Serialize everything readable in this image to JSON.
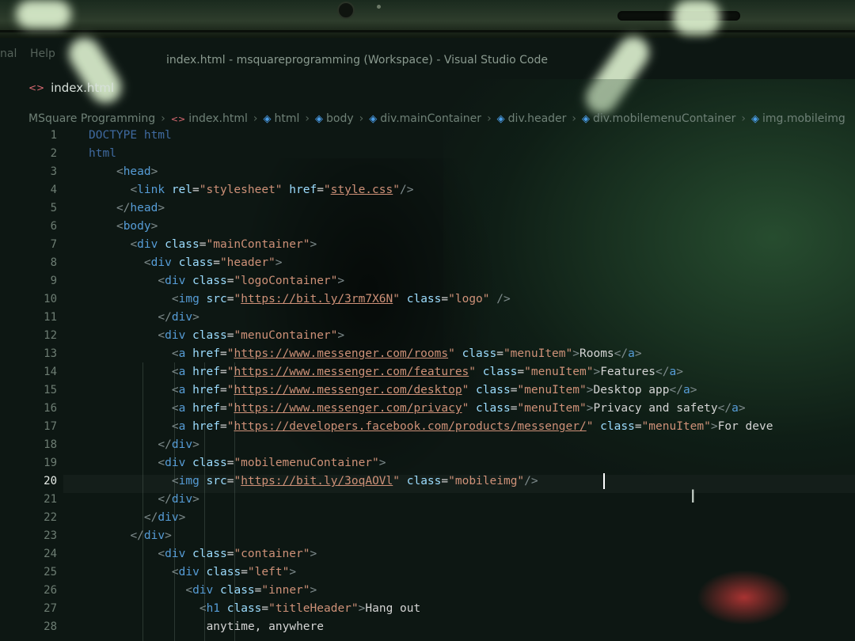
{
  "window": {
    "menu_fragment": "nal",
    "menu_fragment2": "Help",
    "title": "index.html - msquareprogramming (Workspace) - Visual Studio Code"
  },
  "tab": {
    "label": "index.html"
  },
  "breadcrumb": [
    {
      "label": "MSquare Programming",
      "icon": "none"
    },
    {
      "label": "index.html",
      "icon": "html-file-icon"
    },
    {
      "label": "html",
      "icon": "cube-icon"
    },
    {
      "label": "body",
      "icon": "cube-icon"
    },
    {
      "label": "div.mainContainer",
      "icon": "cube-icon"
    },
    {
      "label": "div.header",
      "icon": "cube-icon"
    },
    {
      "label": "div.mobilemenuContainer",
      "icon": "cube-icon"
    },
    {
      "label": "img.mobileimg",
      "icon": "cube-icon"
    }
  ],
  "editor": {
    "active_line": 20,
    "lines": [
      {
        "n": "1",
        "tokens": [
          [
            "dim",
            "DOCTYPE html"
          ]
        ]
      },
      {
        "n": "2",
        "tokens": [
          [
            "dim",
            "html"
          ]
        ]
      },
      {
        "n": "3",
        "tokens": [
          [
            "b",
            "<"
          ],
          [
            "t",
            "head"
          ],
          [
            "b",
            ">"
          ]
        ]
      },
      {
        "n": "4",
        "tokens": [
          [
            "b",
            "<"
          ],
          [
            "t",
            "link "
          ],
          [
            "a",
            "rel"
          ],
          [
            "w",
            "="
          ],
          [
            "s",
            "\"stylesheet\""
          ],
          [
            "w",
            " "
          ],
          [
            "a",
            "href"
          ],
          [
            "w",
            "="
          ],
          [
            "s",
            "\""
          ],
          [
            "u",
            "style.css"
          ],
          [
            "s",
            "\""
          ],
          [
            "b",
            "/>"
          ]
        ]
      },
      {
        "n": "5",
        "tokens": [
          [
            "b",
            "</"
          ],
          [
            "t",
            "head"
          ],
          [
            "b",
            ">"
          ]
        ]
      },
      {
        "n": "6",
        "tokens": [
          [
            "b",
            "<"
          ],
          [
            "t",
            "body"
          ],
          [
            "b",
            ">"
          ]
        ]
      },
      {
        "n": "7",
        "tokens": [
          [
            "b",
            "<"
          ],
          [
            "t",
            "div "
          ],
          [
            "a",
            "class"
          ],
          [
            "w",
            "="
          ],
          [
            "s",
            "\"mainContainer\""
          ],
          [
            "b",
            ">"
          ]
        ]
      },
      {
        "n": "8",
        "tokens": [
          [
            "b",
            "<"
          ],
          [
            "t",
            "div "
          ],
          [
            "a",
            "class"
          ],
          [
            "w",
            "="
          ],
          [
            "s",
            "\"header\""
          ],
          [
            "b",
            ">"
          ]
        ]
      },
      {
        "n": "9",
        "tokens": [
          [
            "b",
            "<"
          ],
          [
            "t",
            "div "
          ],
          [
            "a",
            "class"
          ],
          [
            "w",
            "="
          ],
          [
            "s",
            "\"logoContainer\""
          ],
          [
            "b",
            ">"
          ]
        ]
      },
      {
        "n": "10",
        "tokens": [
          [
            "b",
            "<"
          ],
          [
            "t",
            "img "
          ],
          [
            "a",
            "src"
          ],
          [
            "w",
            "="
          ],
          [
            "s",
            "\""
          ],
          [
            "u",
            "https://bit.ly/3rm7X6N"
          ],
          [
            "s",
            "\""
          ],
          [
            "w",
            " "
          ],
          [
            "a",
            "class"
          ],
          [
            "w",
            "="
          ],
          [
            "s",
            "\"logo\""
          ],
          [
            "w",
            " "
          ],
          [
            "b",
            "/>"
          ]
        ]
      },
      {
        "n": "11",
        "tokens": [
          [
            "b",
            "</"
          ],
          [
            "t",
            "div"
          ],
          [
            "b",
            ">"
          ]
        ]
      },
      {
        "n": "12",
        "tokens": [
          [
            "b",
            "<"
          ],
          [
            "t",
            "div "
          ],
          [
            "a",
            "class"
          ],
          [
            "w",
            "="
          ],
          [
            "s",
            "\"menuContainer\""
          ],
          [
            "b",
            ">"
          ]
        ]
      },
      {
        "n": "13",
        "tokens": [
          [
            "b",
            "<"
          ],
          [
            "t",
            "a "
          ],
          [
            "a",
            "href"
          ],
          [
            "w",
            "="
          ],
          [
            "s",
            "\""
          ],
          [
            "u",
            "https://www.messenger.com/rooms"
          ],
          [
            "s",
            "\""
          ],
          [
            "w",
            " "
          ],
          [
            "a",
            "class"
          ],
          [
            "w",
            "="
          ],
          [
            "s",
            "\"menuItem\""
          ],
          [
            "b",
            ">"
          ],
          [
            "w",
            "Rooms"
          ],
          [
            "b",
            "</"
          ],
          [
            "t",
            "a"
          ],
          [
            "b",
            ">"
          ]
        ]
      },
      {
        "n": "14",
        "tokens": [
          [
            "b",
            "<"
          ],
          [
            "t",
            "a "
          ],
          [
            "a",
            "href"
          ],
          [
            "w",
            "="
          ],
          [
            "s",
            "\""
          ],
          [
            "u",
            "https://www.messenger.com/features"
          ],
          [
            "s",
            "\""
          ],
          [
            "w",
            " "
          ],
          [
            "a",
            "class"
          ],
          [
            "w",
            "="
          ],
          [
            "s",
            "\"menuItem\""
          ],
          [
            "b",
            ">"
          ],
          [
            "w",
            "Features"
          ],
          [
            "b",
            "</"
          ],
          [
            "t",
            "a"
          ],
          [
            "b",
            ">"
          ]
        ]
      },
      {
        "n": "15",
        "tokens": [
          [
            "b",
            "<"
          ],
          [
            "t",
            "a "
          ],
          [
            "a",
            "href"
          ],
          [
            "w",
            "="
          ],
          [
            "s",
            "\""
          ],
          [
            "u",
            "https://www.messenger.com/desktop"
          ],
          [
            "s",
            "\""
          ],
          [
            "w",
            " "
          ],
          [
            "a",
            "class"
          ],
          [
            "w",
            "="
          ],
          [
            "s",
            "\"menuItem\""
          ],
          [
            "b",
            ">"
          ],
          [
            "w",
            "Desktop app"
          ],
          [
            "b",
            "</"
          ],
          [
            "t",
            "a"
          ],
          [
            "b",
            ">"
          ]
        ]
      },
      {
        "n": "16",
        "tokens": [
          [
            "b",
            "<"
          ],
          [
            "t",
            "a "
          ],
          [
            "a",
            "href"
          ],
          [
            "w",
            "="
          ],
          [
            "s",
            "\""
          ],
          [
            "u",
            "https://www.messenger.com/privacy"
          ],
          [
            "s",
            "\""
          ],
          [
            "w",
            " "
          ],
          [
            "a",
            "class"
          ],
          [
            "w",
            "="
          ],
          [
            "s",
            "\"menuItem\""
          ],
          [
            "b",
            ">"
          ],
          [
            "w",
            "Privacy and safety"
          ],
          [
            "b",
            "</"
          ],
          [
            "t",
            "a"
          ],
          [
            "b",
            ">"
          ]
        ]
      },
      {
        "n": "17",
        "tokens": [
          [
            "b",
            "<"
          ],
          [
            "t",
            "a "
          ],
          [
            "a",
            "href"
          ],
          [
            "w",
            "="
          ],
          [
            "s",
            "\""
          ],
          [
            "u",
            "https://developers.facebook.com/products/messenger/"
          ],
          [
            "s",
            "\""
          ],
          [
            "w",
            " "
          ],
          [
            "a",
            "class"
          ],
          [
            "w",
            "="
          ],
          [
            "s",
            "\"menuItem\""
          ],
          [
            "b",
            ">"
          ],
          [
            "w",
            "For deve"
          ]
        ]
      },
      {
        "n": "18",
        "tokens": [
          [
            "b",
            "</"
          ],
          [
            "t",
            "div"
          ],
          [
            "b",
            ">"
          ]
        ]
      },
      {
        "n": "19",
        "tokens": [
          [
            "b",
            "<"
          ],
          [
            "t",
            "div "
          ],
          [
            "a",
            "class"
          ],
          [
            "w",
            "="
          ],
          [
            "s",
            "\"mobilemenuContainer\""
          ],
          [
            "b",
            ">"
          ]
        ]
      },
      {
        "n": "20",
        "tokens": [
          [
            "b",
            "<"
          ],
          [
            "t",
            "img "
          ],
          [
            "a",
            "src"
          ],
          [
            "w",
            "="
          ],
          [
            "s",
            "\""
          ],
          [
            "u",
            "https://bit.ly/3oqAOVl"
          ],
          [
            "s",
            "\""
          ],
          [
            "w",
            " "
          ],
          [
            "a",
            "class"
          ],
          [
            "w",
            "="
          ],
          [
            "s",
            "\"mobileimg\""
          ],
          [
            "b",
            "/>"
          ]
        ]
      },
      {
        "n": "21",
        "tokens": [
          [
            "b",
            "</"
          ],
          [
            "t",
            "div"
          ],
          [
            "b",
            ">"
          ]
        ]
      },
      {
        "n": "22",
        "tokens": [
          [
            "b",
            "</"
          ],
          [
            "t",
            "div"
          ],
          [
            "b",
            ">"
          ]
        ]
      },
      {
        "n": "23",
        "tokens": [
          [
            "b",
            "</"
          ],
          [
            "t",
            "div"
          ],
          [
            "b",
            ">"
          ]
        ]
      },
      {
        "n": "24",
        "tokens": [
          [
            "b",
            "<"
          ],
          [
            "t",
            "div "
          ],
          [
            "a",
            "class"
          ],
          [
            "w",
            "="
          ],
          [
            "s",
            "\"container\""
          ],
          [
            "b",
            ">"
          ]
        ]
      },
      {
        "n": "25",
        "tokens": [
          [
            "b",
            "<"
          ],
          [
            "t",
            "div "
          ],
          [
            "a",
            "class"
          ],
          [
            "w",
            "="
          ],
          [
            "s",
            "\"left\""
          ],
          [
            "b",
            ">"
          ]
        ]
      },
      {
        "n": "26",
        "tokens": [
          [
            "b",
            "<"
          ],
          [
            "t",
            "div "
          ],
          [
            "a",
            "class"
          ],
          [
            "w",
            "="
          ],
          [
            "s",
            "\"inner\""
          ],
          [
            "b",
            ">"
          ]
        ]
      },
      {
        "n": "27",
        "tokens": [
          [
            "b",
            "<"
          ],
          [
            "t",
            "h1 "
          ],
          [
            "a",
            "class"
          ],
          [
            "w",
            "="
          ],
          [
            "s",
            "\"titleHeader\""
          ],
          [
            "b",
            ">"
          ],
          [
            "w",
            "Hang out"
          ]
        ]
      },
      {
        "n": "28",
        "tokens": [
          [
            "w",
            "anytime, anywhere"
          ]
        ]
      }
    ]
  }
}
